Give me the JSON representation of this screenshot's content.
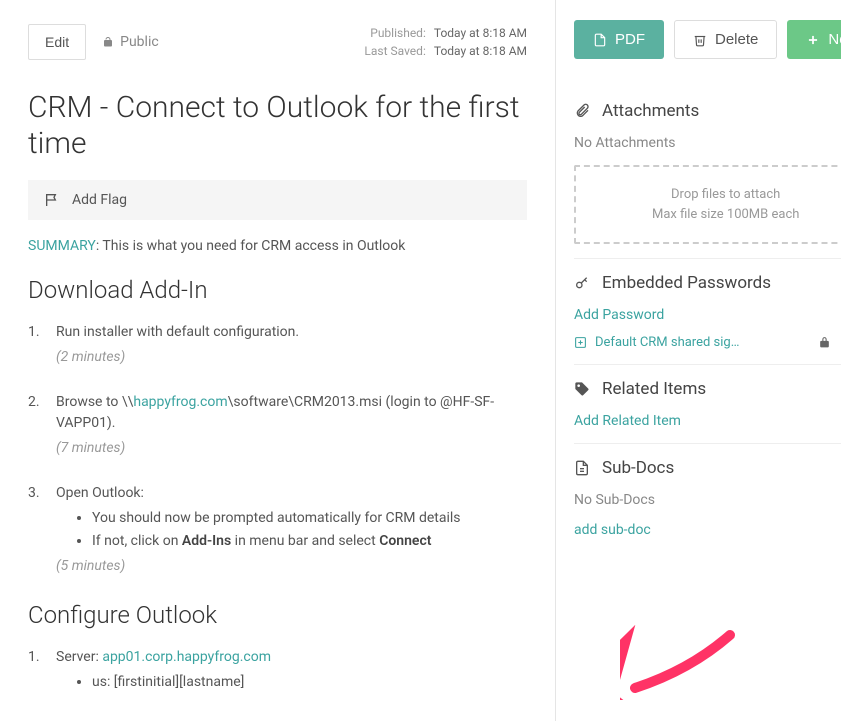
{
  "header": {
    "edit": "Edit",
    "visibility": "Public",
    "published_label": "Published:",
    "published_value": "Today at 8:18 AM",
    "saved_label": "Last Saved:",
    "saved_value": "Today at 8:18 AM"
  },
  "actions": {
    "pdf": "PDF",
    "delete": "Delete",
    "new": "New"
  },
  "title": "CRM - Connect to Outlook for the first time",
  "flag": "Add Flag",
  "summary_label": "SUMMARY",
  "summary_text": ": This is what you need for CRM access in Outlook",
  "section1": "Download Add-In",
  "steps1": {
    "s1": "Run installer with default configuration.",
    "d1": "(2 minutes)",
    "s2a": "Browse to \\\\",
    "s2link": "happyfrog.com",
    "s2b": "\\software\\CRM2013.msi (login to @HF-SF-VAPP01).",
    "d2": "(7 minutes)",
    "s3": "Open Outlook:",
    "s3b1": "You should now be prompted automatically for CRM details",
    "s3b2a": "If not, click on ",
    "s3b2b": "Add-Ins",
    "s3b2c": " in menu bar and select ",
    "s3b2d": "Connect",
    "d3": "(5 minutes)"
  },
  "section2": "Configure Outlook",
  "steps2": {
    "s1a": "Server:  ",
    "s1link": "app01.corp.happyfrog.com",
    "s1b1a": "us: [firstinitial][lastname]"
  },
  "sidebar": {
    "attachments": {
      "title": "Attachments",
      "empty": "No Attachments",
      "drop1": "Drop files to attach",
      "drop2": "Max file size 100MB each"
    },
    "passwords": {
      "title": "Embedded Passwords",
      "add": "Add Password",
      "item": "Default CRM shared sign…"
    },
    "related": {
      "title": "Related Items",
      "add": "Add Related Item"
    },
    "subdocs": {
      "title": "Sub-Docs",
      "empty": "No Sub-Docs",
      "add": "add sub-doc"
    }
  }
}
